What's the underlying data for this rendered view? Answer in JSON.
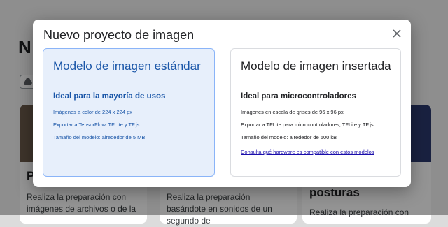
{
  "background": {
    "page_title": "N",
    "cards": [
      {
        "heading": "P",
        "description": "Realiza la preparación con imágenes de archivos o de la"
      },
      {
        "heading": "",
        "description": "Realiza la preparación basándote en sonidos de un segundo de"
      },
      {
        "heading": "posturas",
        "description": "Realiza la preparación con"
      }
    ]
  },
  "dialog": {
    "title": "Nuevo proyecto de imagen",
    "close_icon": "close-icon",
    "options": [
      {
        "title": "Modelo de imagen estándar",
        "subtitle": "Ideal para la mayoría de usos",
        "features": [
          "Imágenes a color de 224 x 224 px",
          "Exportar a TensorFlow, TFLite y TF.js",
          "Tamaño del modelo: alrededor de 5 MB"
        ],
        "selected": true
      },
      {
        "title": "Modelo de imagen insertada",
        "subtitle": "Ideal para microcontroladores",
        "features": [
          "Imágenes en escala de grises de 96 x 96 px",
          "Exportar a TFLite para microcontroladores, TFLite y TF.js",
          "Tamaño del modelo: alrededor de 500 kB"
        ],
        "link": "Consulta qué hardware es compatible con estos modelos",
        "selected": false
      }
    ]
  },
  "colors": {
    "selected_accent": "#1a56a8",
    "selected_background": "#e7effb",
    "link": "#1a0dab"
  }
}
